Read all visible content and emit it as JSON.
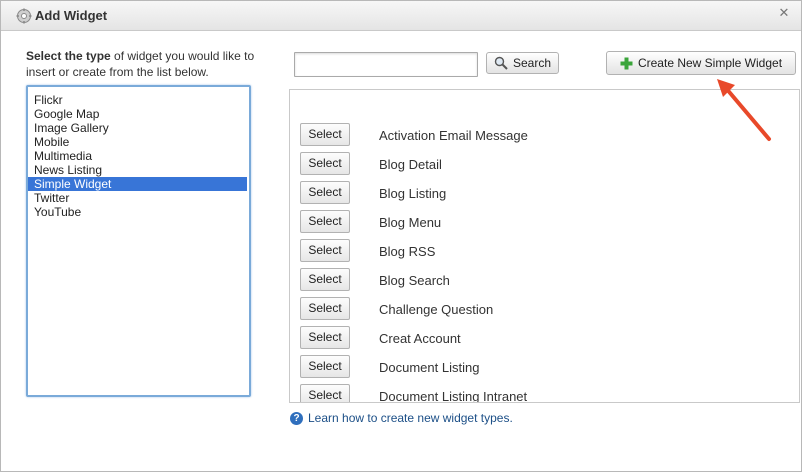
{
  "window": {
    "title": "Add Widget",
    "icon": "gear-icon",
    "close_icon": "close-icon"
  },
  "instructions": {
    "bold": "Select the type",
    "rest": " of widget you would like to insert or create from the list below."
  },
  "types": {
    "items": [
      "Flickr",
      "Google Map",
      "Image Gallery",
      "Mobile",
      "Multimedia",
      "News Listing",
      "Simple Widget",
      "Twitter",
      "YouTube"
    ],
    "selected": "Simple Widget"
  },
  "search": {
    "value": "",
    "placeholder": "",
    "button_label": "Search",
    "button_icon": "magnifier-icon"
  },
  "create": {
    "label": "Create New Simple Widget",
    "icon": "plus-icon"
  },
  "widgets": {
    "select_label": "Select",
    "rows": [
      "Activation Email Message",
      "Blog Detail",
      "Blog Listing",
      "Blog Menu",
      "Blog RSS",
      "Blog Search",
      "Challenge Question",
      "Creat Account",
      "Document Listing",
      "Document Listing Intranet"
    ]
  },
  "help": {
    "text": "Learn how to create new widget types.",
    "icon": "question-icon"
  },
  "colors": {
    "selection": "#3875d7",
    "list_border": "#7aaad9",
    "arrow": "#e8492a",
    "plus": "#3aa53a",
    "link": "#1c4f87"
  }
}
